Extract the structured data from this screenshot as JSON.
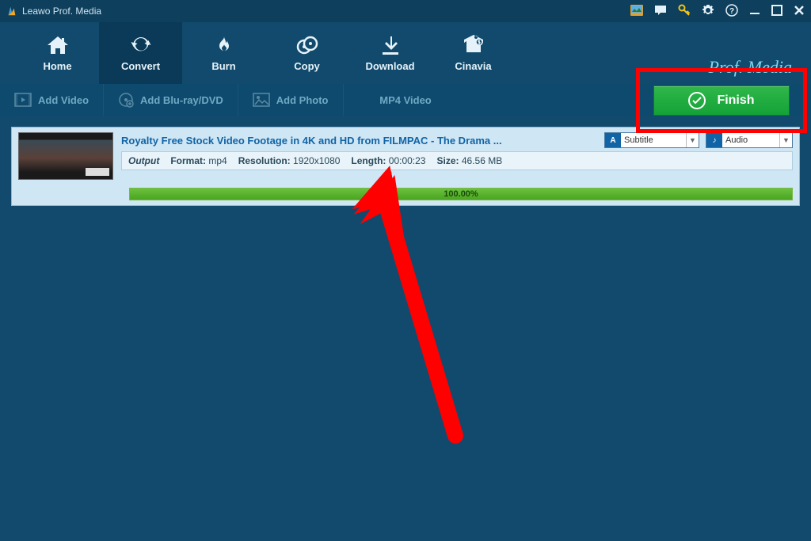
{
  "window": {
    "title": "Leawo Prof. Media",
    "brand": "Prof. Media"
  },
  "nav": {
    "home": "Home",
    "convert": "Convert",
    "burn": "Burn",
    "copy": "Copy",
    "download": "Download",
    "cinavia": "Cinavia"
  },
  "toolbar": {
    "add_video": "Add Video",
    "add_bluray": "Add Blu-ray/DVD",
    "add_photo": "Add Photo",
    "format": "MP4 Video"
  },
  "finish": {
    "label": "Finish"
  },
  "task": {
    "title": "Royalty Free Stock Video Footage in 4K and HD from FILMPAC - The Drama ...",
    "subtitle_label": "Subtitle",
    "audio_label": "Audio",
    "output_label": "Output",
    "format_key": "Format:",
    "format_val": "mp4",
    "resolution_key": "Resolution:",
    "resolution_val": "1920x1080",
    "length_key": "Length:",
    "length_val": "00:00:23",
    "size_key": "Size:",
    "size_val": "46.56 MB",
    "progress": "100.00%"
  }
}
